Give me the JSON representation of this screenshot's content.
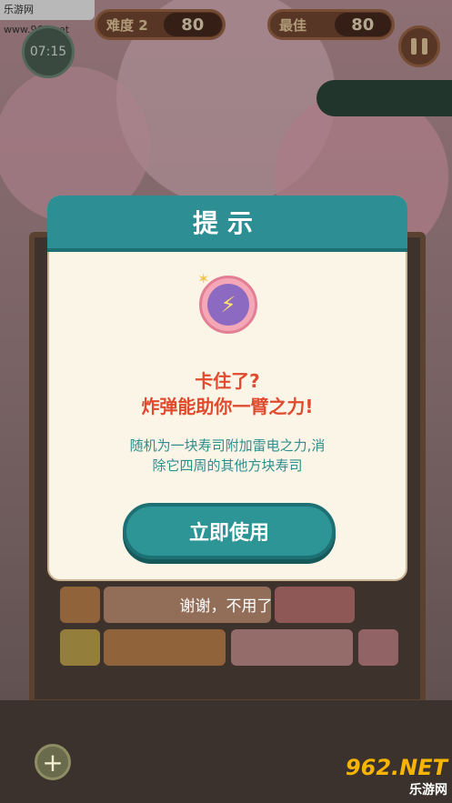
{
  "watermark_top": "乐游网 www.962.net",
  "hud": {
    "difficulty_label": "难度 2",
    "difficulty_value": "80",
    "best_label": "最佳",
    "best_value": "80",
    "timer": "07:15"
  },
  "dialog": {
    "title": "提示",
    "line1": "卡住了?",
    "line2": "炸弹能助你一臂之力!",
    "desc1": "随机为一块寿司附加雷电之力,消",
    "desc2": "除它四周的其他方块寿司",
    "use_button": "立即使用",
    "decline": "谢谢，不用了"
  },
  "bottom": {
    "add_symbol": "+",
    "logo_big": "962.NET",
    "logo_small": "乐游网"
  },
  "icons": [
    "bomb-icon",
    "pause-icon",
    "add-icon"
  ]
}
